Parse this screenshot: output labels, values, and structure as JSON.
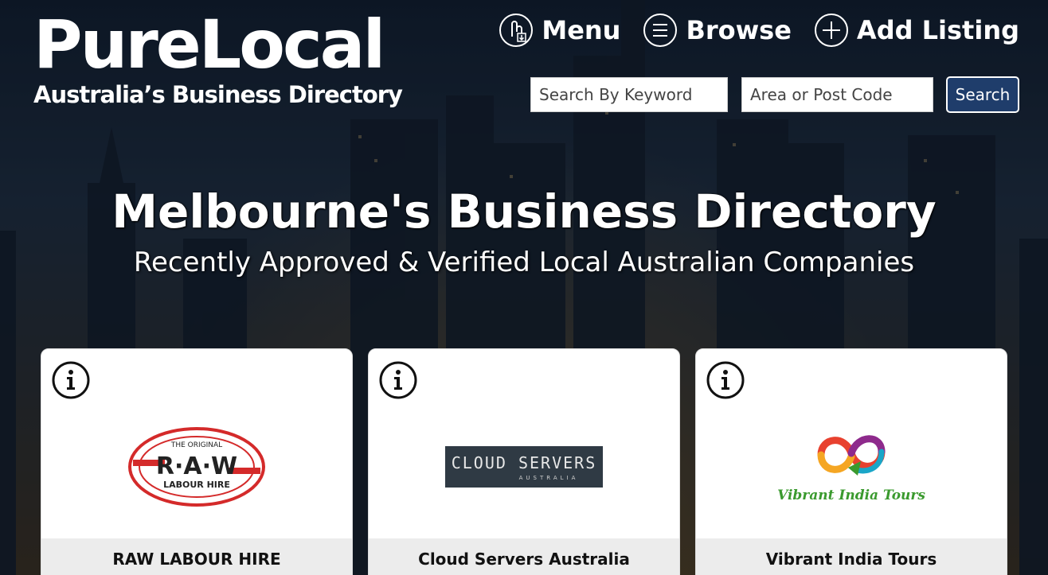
{
  "brand": {
    "title": "PureLocal",
    "subtitle": "Australia’s Business Directory"
  },
  "nav": {
    "menu_label": "Menu",
    "browse_label": "Browse",
    "add_listing_label": "Add Listing"
  },
  "search": {
    "keyword_placeholder": "Search By Keyword",
    "area_placeholder": "Area or Post Code",
    "button_label": "Search"
  },
  "hero": {
    "title": "Melbourne's Business Directory",
    "subtitle": "Recently Approved & Verified Local Australian Companies"
  },
  "listings": [
    {
      "name": "RAW LABOUR HIRE",
      "logo_top": "THE ORIGINAL",
      "logo_main": "R·A·W",
      "logo_bottom": "LABOUR HIRE"
    },
    {
      "name": "Cloud Servers Australia",
      "logo_main": "CLOUD SERVERS",
      "logo_bottom": "AUSTRALIA"
    },
    {
      "name": "Vibrant India Tours",
      "logo_main": "Vibrant India Tours"
    }
  ],
  "colors": {
    "search_button": "#1f3d6b",
    "raw_red": "#d42a2a",
    "cloud_bg": "#2f3a44",
    "vibrant_green": "#3a9a2e"
  },
  "icons": [
    "menu-hand-icon",
    "browse-list-icon",
    "add-plus-icon",
    "info-icon"
  ]
}
